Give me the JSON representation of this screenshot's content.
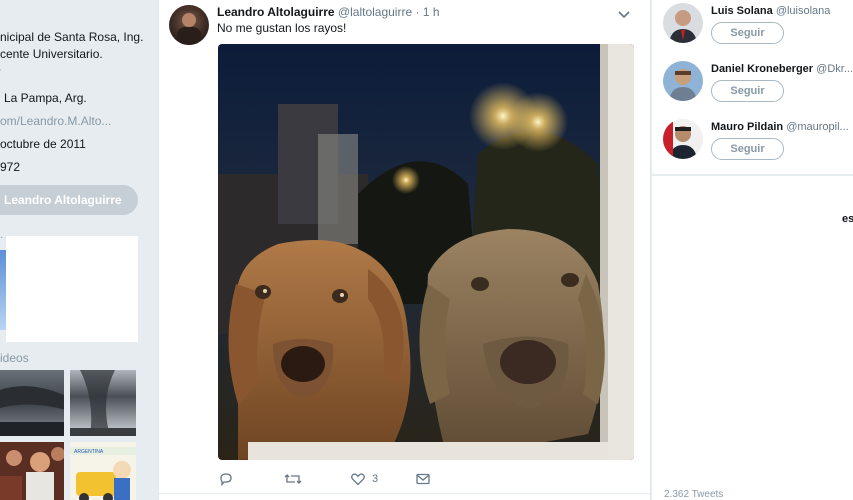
{
  "profile": {
    "bio_line1": "nicipal de Santa Rosa, Ing.",
    "bio_line2": "cente Universitario.",
    "location": "La Pampa, Arg.",
    "website": "om/Leandro.M.Alto...",
    "joined": "octubre de 2011",
    "born": "972",
    "follow_button": "Leandro Altolaguirre",
    "videos_label": "ideos"
  },
  "tweet": {
    "author_name": "Leandro Altolaguirre",
    "author_handle": "@laltolaguirre",
    "time": "· 1 h",
    "text": "No me gustan los rayos!",
    "like_count": "3",
    "icons": [
      "reply-icon",
      "retweet-icon",
      "like-icon",
      "direct-message-icon",
      "chevron-down-icon"
    ]
  },
  "who_to_follow": [
    {
      "name": "Luis Solana",
      "handle": "@luisolana",
      "button": "Seguir"
    },
    {
      "name": "Daniel Kroneberger",
      "handle": "@Dkr...",
      "button": "Seguir"
    },
    {
      "name": "Mauro Pildain",
      "handle": "@mauropil...",
      "button": "Seguir"
    }
  ],
  "right_clip_text": "es",
  "right_footer": "2.362 Tweets",
  "colors": {
    "background": "#e6ecf0",
    "card": "#ffffff",
    "text": "#14171a",
    "muted": "#657786",
    "follow_pill": "#c6cfd6"
  }
}
